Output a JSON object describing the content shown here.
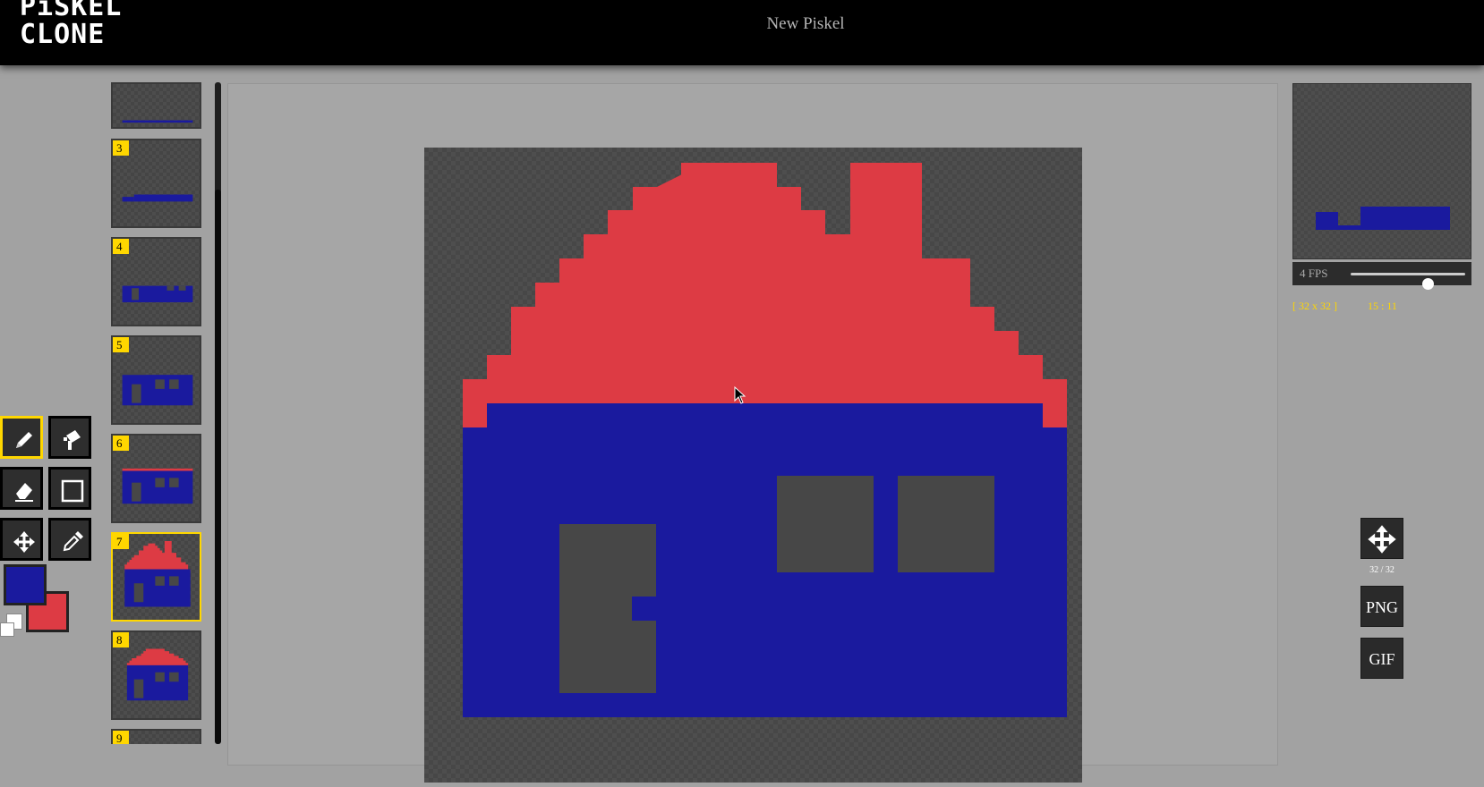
{
  "app": {
    "logo_line1": "PiSKEL",
    "logo_line2": "CLONE",
    "document_title": "New Piskel"
  },
  "tools": [
    {
      "name": "pen",
      "icon": "pencil-icon",
      "selected": true
    },
    {
      "name": "bucket",
      "icon": "paint-bucket-icon",
      "selected": false
    },
    {
      "name": "eraser",
      "icon": "eraser-icon",
      "selected": false
    },
    {
      "name": "rectangle",
      "icon": "rectangle-icon",
      "selected": false
    },
    {
      "name": "move",
      "icon": "move-arrows-icon",
      "selected": false
    },
    {
      "name": "color-picker",
      "icon": "eyedropper-icon",
      "selected": false
    }
  ],
  "colors": {
    "primary": "#1a1a9e",
    "secondary": "#dd3b44",
    "transparent": "#474747"
  },
  "frames": [
    {
      "number": "",
      "selected": false
    },
    {
      "number": "3",
      "selected": false
    },
    {
      "number": "4",
      "selected": false
    },
    {
      "number": "5",
      "selected": false
    },
    {
      "number": "6",
      "selected": false
    },
    {
      "number": "7",
      "selected": true
    },
    {
      "number": "8",
      "selected": false
    },
    {
      "number": "9",
      "selected": false
    }
  ],
  "preview": {
    "fps_label": "4 FPS",
    "fps_value": 4,
    "canvas_size": "[ 32 x 32 ]",
    "cursor_coords": "15 : 11"
  },
  "side_actions": {
    "resize_label": "32 / 32",
    "png_label": "PNG",
    "gif_label": "GIF"
  }
}
